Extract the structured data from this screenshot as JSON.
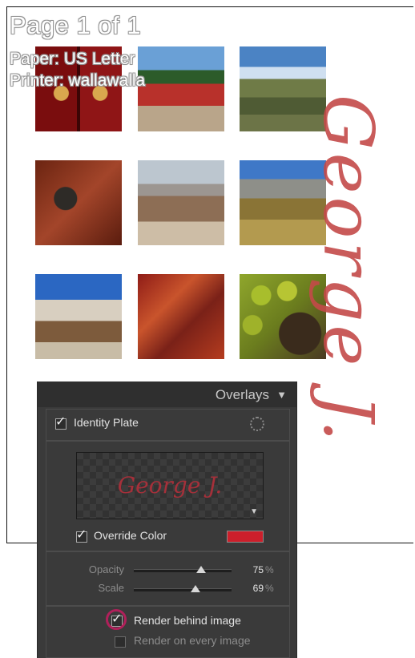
{
  "page_info": {
    "page": "Page 1 of 1",
    "paper": "Paper: US Letter",
    "printer": "Printer: wallawalla"
  },
  "watermark": {
    "text": "George J."
  },
  "thumbnails": [
    {
      "name": "photo-red-door"
    },
    {
      "name": "photo-temple"
    },
    {
      "name": "photo-river-valley"
    },
    {
      "name": "photo-door-knocker"
    },
    {
      "name": "photo-palace"
    },
    {
      "name": "photo-field"
    },
    {
      "name": "photo-stupa"
    },
    {
      "name": "photo-weaving-hands"
    },
    {
      "name": "photo-apples"
    }
  ],
  "overlays_panel": {
    "title": "Overlays",
    "identity_plate": {
      "label": "Identity Plate",
      "checked": true,
      "plate_text": "George J."
    },
    "override_color": {
      "label": "Override Color",
      "checked": true,
      "color": "#cc1f2b"
    },
    "opacity": {
      "label": "Opacity",
      "value": "75",
      "unit": "%"
    },
    "scale": {
      "label": "Scale",
      "value": "69",
      "unit": "%"
    },
    "render_behind_image": {
      "label": "Render behind image",
      "checked": true
    },
    "render_on_every_image": {
      "label": "Render on every image",
      "checked": false
    }
  }
}
